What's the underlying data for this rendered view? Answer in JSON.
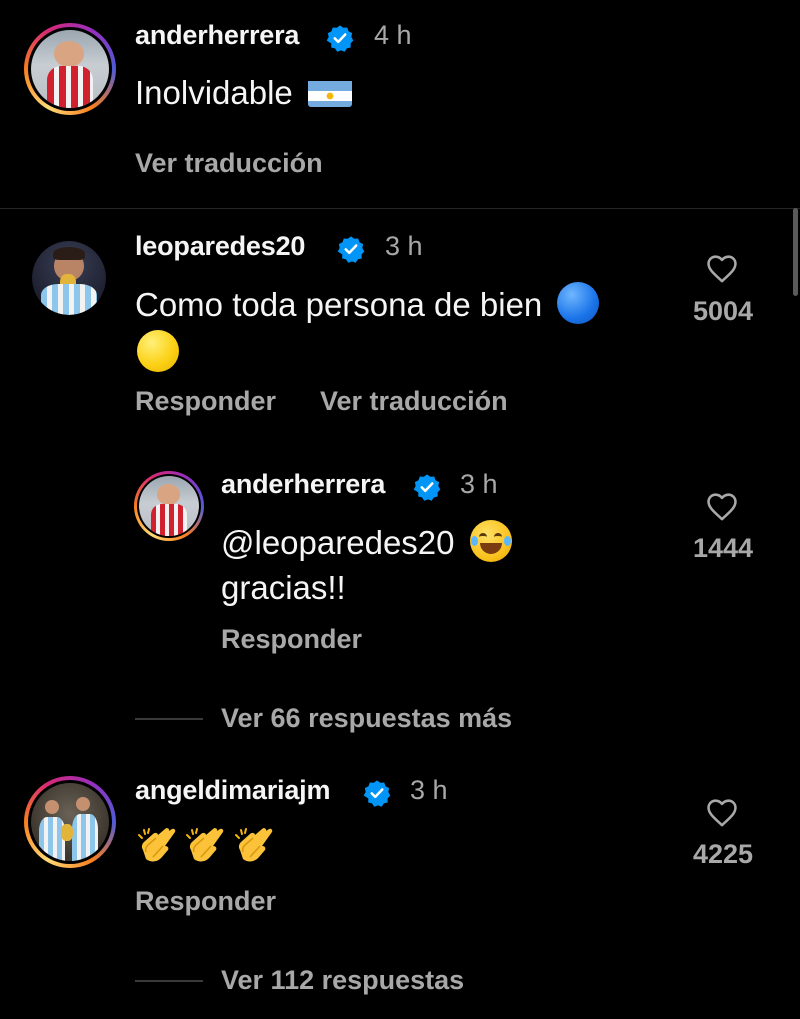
{
  "post": {
    "username": "anderherrera",
    "time": "4 h",
    "caption": "Inolvidable",
    "translate": "Ver traducción"
  },
  "comments": [
    {
      "username": "leoparedes20",
      "time": "3 h",
      "text_line1": "Como toda persona de bien",
      "likes": "5004",
      "reply": "Responder",
      "translate": "Ver traducción"
    },
    {
      "username": "anderherrera",
      "time": "3 h",
      "text_line1": "@leoparedes20",
      "text_line2": "gracias!!",
      "likes": "1444",
      "reply": "Responder"
    },
    {
      "username": "angeldimariajm",
      "time": "3 h",
      "likes": "4225",
      "reply": "Responder"
    }
  ],
  "more_replies_1": "Ver 66 respuestas más",
  "more_replies_2": "Ver 112 respuestas",
  "icons": {
    "verified": "verified-badge-icon",
    "like": "heart-icon",
    "flag": "argentina-flag-icon"
  },
  "colors": {
    "background": "#000000",
    "text": "#f5f5f5",
    "secondary": "#a8a8a8",
    "verified": "#0095f6"
  }
}
